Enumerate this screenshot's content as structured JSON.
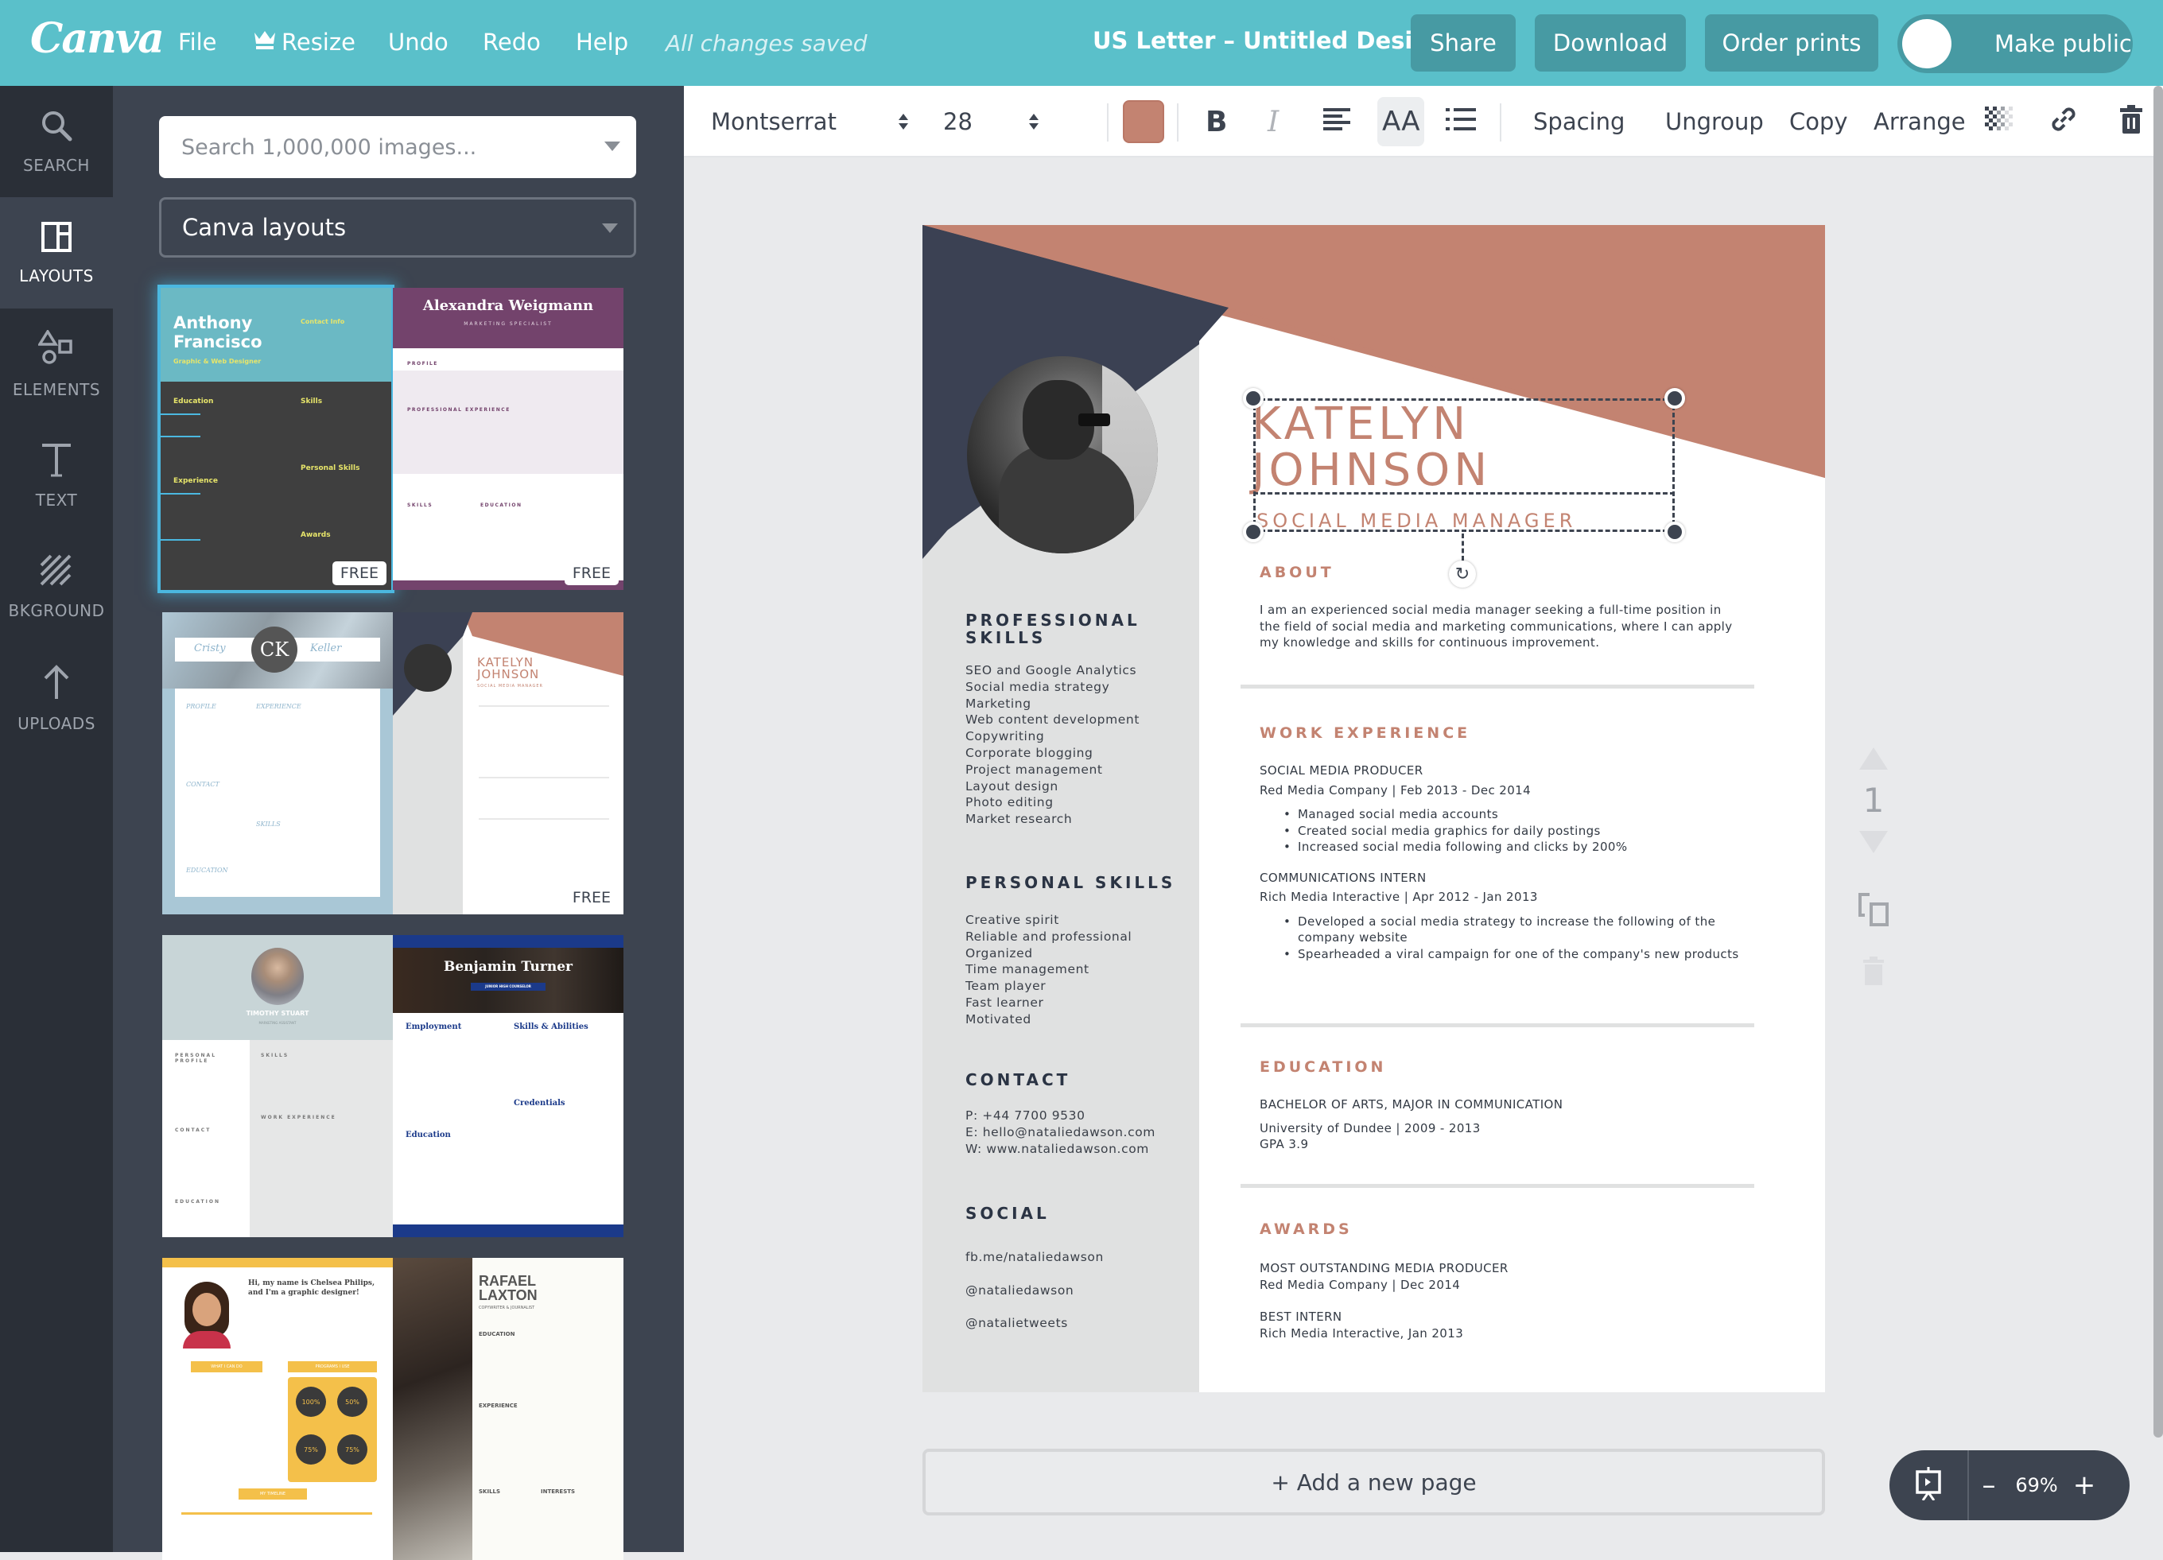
{
  "topbar": {
    "logo": "Canva",
    "menu": [
      "File",
      "Resize",
      "Undo",
      "Redo",
      "Help"
    ],
    "status": "All changes saved",
    "doc_title": "US Letter – Untitled Design",
    "buttons": {
      "share": "Share",
      "download": "Download",
      "order_prints": "Order prints",
      "make_public": "Make public"
    }
  },
  "nav": {
    "items": [
      {
        "label": "SEARCH",
        "icon": "search-icon"
      },
      {
        "label": "LAYOUTS",
        "icon": "layouts-icon",
        "active": true
      },
      {
        "label": "ELEMENTS",
        "icon": "shapes-icon"
      },
      {
        "label": "TEXT",
        "icon": "text-icon"
      },
      {
        "label": "BKGROUND",
        "icon": "background-icon"
      },
      {
        "label": "UPLOADS",
        "icon": "upload-arrow-icon"
      }
    ]
  },
  "panel": {
    "search_placeholder": "Search 1,000,000 images...",
    "filter_selected": "Canva layouts",
    "templates": [
      {
        "name": "Anthony Francisco",
        "subtitle": "Graphic & Web Designer",
        "extra": "Contact Info",
        "sections": [
          "Education",
          "Skills",
          "Experience",
          "Personal Skills",
          "Awards"
        ],
        "badge": "FREE",
        "selected": true
      },
      {
        "name": "Alexandra Weigmann",
        "subtitle": "MARKETING SPECIALIST",
        "sections": [
          "PROFILE",
          "PROFESSIONAL EXPERIENCE",
          "SKILLS",
          "EDUCATION"
        ],
        "badge": "FREE"
      },
      {
        "first": "Cristy",
        "initials": "CK",
        "last": "Keller",
        "sections": [
          "PROFILE",
          "EXPERIENCE",
          "CONTACT",
          "SKILLS",
          "EDUCATION"
        ]
      },
      {
        "name_line1": "KATELYN",
        "name_line2": "JOHNSON",
        "subtitle": "SOCIAL MEDIA MANAGER",
        "badge": "FREE"
      },
      {
        "name": "TIMOTHY STUART",
        "subtitle": "MARKETING ASSISTANT",
        "sections": [
          "PERSONAL PROFILE",
          "SKILLS",
          "WORK EXPERIENCE",
          "CONTACT",
          "EDUCATION"
        ]
      },
      {
        "name": "Benjamin Turner",
        "subtitle": "JUNIOR HIGH COUNSELOR",
        "sections": [
          "Employment",
          "Skills & Abilities",
          "Credentials",
          "Education"
        ]
      },
      {
        "name": "Hi, my name is Chelsea Philips, and I'm a graphic designer!",
        "sections": [
          "WHAT I CAN DO",
          "PROGRAMS I USE",
          "MY TIMELINE"
        ],
        "stats": [
          "100%",
          "50%",
          "75%",
          "75%"
        ]
      },
      {
        "name_line1": "RAFAEL",
        "name_line2": "LAXTON",
        "subtitle": "COPYWRITER & JOURNALIST",
        "sections": [
          "EDUCATION",
          "EXPERIENCE",
          "SKILLS",
          "INTERESTS"
        ]
      }
    ]
  },
  "toolbar": {
    "font": "Montserrat",
    "size": "28",
    "text_color": "#c38371",
    "bold": "B",
    "italic": "I",
    "case": "AA",
    "spacing": "Spacing",
    "ungroup": "Ungroup",
    "copy": "Copy",
    "arrange": "Arrange"
  },
  "resume": {
    "name_line1": "KATELYN",
    "name_line2": "JOHNSON",
    "title": "SOCIAL MEDIA MANAGER",
    "accent": "#c38371",
    "navy": "#3b4153",
    "left": {
      "pro_skills_head_1": "PROFESSIONAL",
      "pro_skills_head_2": "SKILLS",
      "pro_skills": [
        "SEO and Google Analytics",
        "Social media strategy",
        "Marketing",
        "Web content development",
        "Copywriting",
        "Corporate blogging",
        "Project management",
        "Layout design",
        "Photo editing",
        "Market research"
      ],
      "personal_head": "PERSONAL SKILLS",
      "personal": [
        "Creative spirit",
        "Reliable and professional",
        "Organized",
        "Time management",
        "Team player",
        "Fast learner",
        "Motivated"
      ],
      "contact_head": "CONTACT",
      "contact": [
        "P: +44 7700 9530",
        "E: hello@nataliedawson.com",
        "W: www.nataliedawson.com"
      ],
      "social_head": "SOCIAL",
      "social": [
        "fb.me/nataliedawson",
        "@nataliedawson",
        "@natalietweets"
      ]
    },
    "about_head": "ABOUT",
    "about": "I am an experienced social media manager seeking a full-time position in the field of social media and marketing communications, where I can apply my knowledge and skills for continuous improvement.",
    "work_head": "WORK EXPERIENCE",
    "jobs": [
      {
        "role": "SOCIAL MEDIA PRODUCER",
        "company": "Red Media Company | Feb 2013 - Dec 2014",
        "bullets": [
          "Managed social media accounts",
          "Created social media graphics for daily postings",
          "Increased social media following and clicks by 200%"
        ]
      },
      {
        "role": "COMMUNICATIONS INTERN",
        "company": "Rich Media Interactive | Apr 2012 - Jan 2013",
        "bullets": [
          "Developed a social media strategy to increase the following of the company website",
          "Spearheaded a viral campaign for one of the company's new products"
        ]
      }
    ],
    "edu_head": "EDUCATION",
    "degree": "BACHELOR OF ARTS, MAJOR IN COMMUNICATION",
    "school": "University of Dundee | 2009 - 2013",
    "gpa": "GPA 3.9",
    "awards_head": "AWARDS",
    "awards": [
      {
        "title": "MOST OUTSTANDING MEDIA PRODUCER",
        "detail": "Red Media Company | Dec 2014"
      },
      {
        "title": "BEST INTERN",
        "detail": "Rich Media Interactive, Jan 2013"
      }
    ]
  },
  "canvas": {
    "add_page": "+ Add a new page",
    "page_number": "1",
    "zoom": "69%",
    "zoom_minus": "–",
    "zoom_plus": "+"
  }
}
